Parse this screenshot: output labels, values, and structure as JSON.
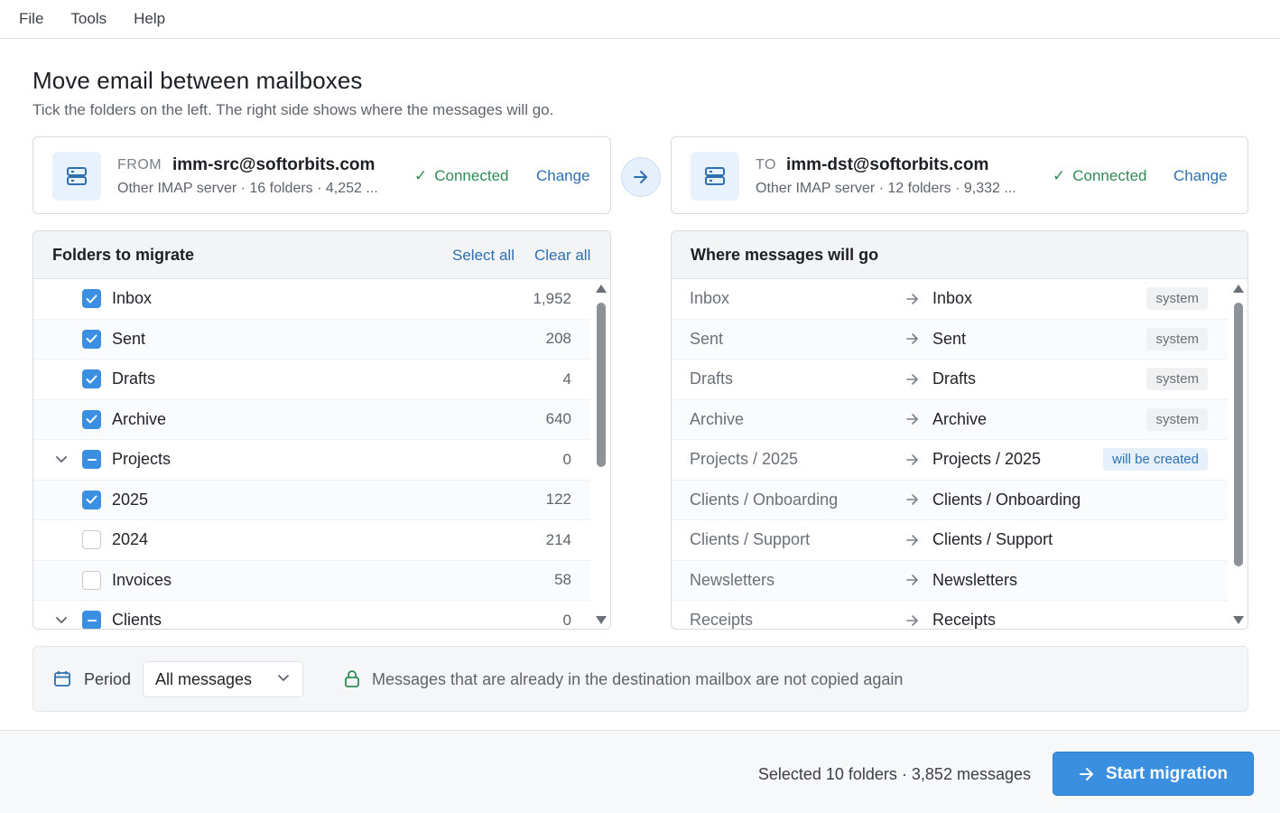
{
  "menu": {
    "items": [
      "File",
      "Tools",
      "Help"
    ]
  },
  "header": {
    "title": "Move email between mailboxes",
    "subtitle": "Tick the folders on the left. The right side shows where the messages will go."
  },
  "source": {
    "label": "FROM",
    "email": "imm-src@softorbits.com",
    "meta": "Other IMAP server · 16 folders · 4,252 ...",
    "status": "Connected",
    "change": "Change"
  },
  "destination": {
    "label": "TO",
    "email": "imm-dst@softorbits.com",
    "meta": "Other IMAP server · 12 folders · 9,332 ...",
    "status": "Connected",
    "change": "Change"
  },
  "folders_panel": {
    "title": "Folders to migrate",
    "select_all": "Select all",
    "clear_all": "Clear all",
    "rows": [
      {
        "name": "Inbox",
        "count": "1,952",
        "state": "checked",
        "indent": 0,
        "expander": false
      },
      {
        "name": "Sent",
        "count": "208",
        "state": "checked",
        "indent": 0,
        "expander": false
      },
      {
        "name": "Drafts",
        "count": "4",
        "state": "checked",
        "indent": 0,
        "expander": false
      },
      {
        "name": "Archive",
        "count": "640",
        "state": "checked",
        "indent": 0,
        "expander": false
      },
      {
        "name": "Projects",
        "count": "0",
        "state": "partial",
        "indent": 0,
        "expander": true
      },
      {
        "name": "2025",
        "count": "122",
        "state": "checked",
        "indent": 1,
        "expander": false
      },
      {
        "name": "2024",
        "count": "214",
        "state": "unchecked",
        "indent": 1,
        "expander": false
      },
      {
        "name": "Invoices",
        "count": "58",
        "state": "unchecked",
        "indent": 1,
        "expander": false
      },
      {
        "name": "Clients",
        "count": "0",
        "state": "partial",
        "indent": 0,
        "expander": true
      }
    ]
  },
  "mapping_panel": {
    "title": "Where messages will go",
    "rows": [
      {
        "source": "Inbox",
        "target": "Inbox",
        "tag": "system",
        "tag_kind": "sys"
      },
      {
        "source": "Sent",
        "target": "Sent",
        "tag": "system",
        "tag_kind": "sys"
      },
      {
        "source": "Drafts",
        "target": "Drafts",
        "tag": "system",
        "tag_kind": "sys"
      },
      {
        "source": "Archive",
        "target": "Archive",
        "tag": "system",
        "tag_kind": "sys"
      },
      {
        "source": "Projects / 2025",
        "target": "Projects / 2025",
        "tag": "will be created",
        "tag_kind": "new"
      },
      {
        "source": "Clients / Onboarding",
        "target": "Clients / Onboarding",
        "tag": "",
        "tag_kind": ""
      },
      {
        "source": "Clients / Support",
        "target": "Clients / Support",
        "tag": "",
        "tag_kind": ""
      },
      {
        "source": "Newsletters",
        "target": "Newsletters",
        "tag": "",
        "tag_kind": ""
      },
      {
        "source": "Receipts",
        "target": "Receipts",
        "tag": "",
        "tag_kind": ""
      }
    ]
  },
  "period": {
    "label": "Period",
    "value": "All messages",
    "note": "Messages that are already in the destination mailbox are not copied again"
  },
  "footer": {
    "summary": "Selected 10 folders · 3,852 messages",
    "start_label": "Start migration"
  },
  "colors": {
    "accent": "#3b8fe0",
    "link": "#2e6fb0",
    "connected": "#2f8a56"
  },
  "icons": [
    "server-icon",
    "check-icon",
    "arrow-right-icon",
    "chevron-down-icon",
    "calendar-icon",
    "lock-icon",
    "scroll-up-icon",
    "scroll-down-icon"
  ]
}
